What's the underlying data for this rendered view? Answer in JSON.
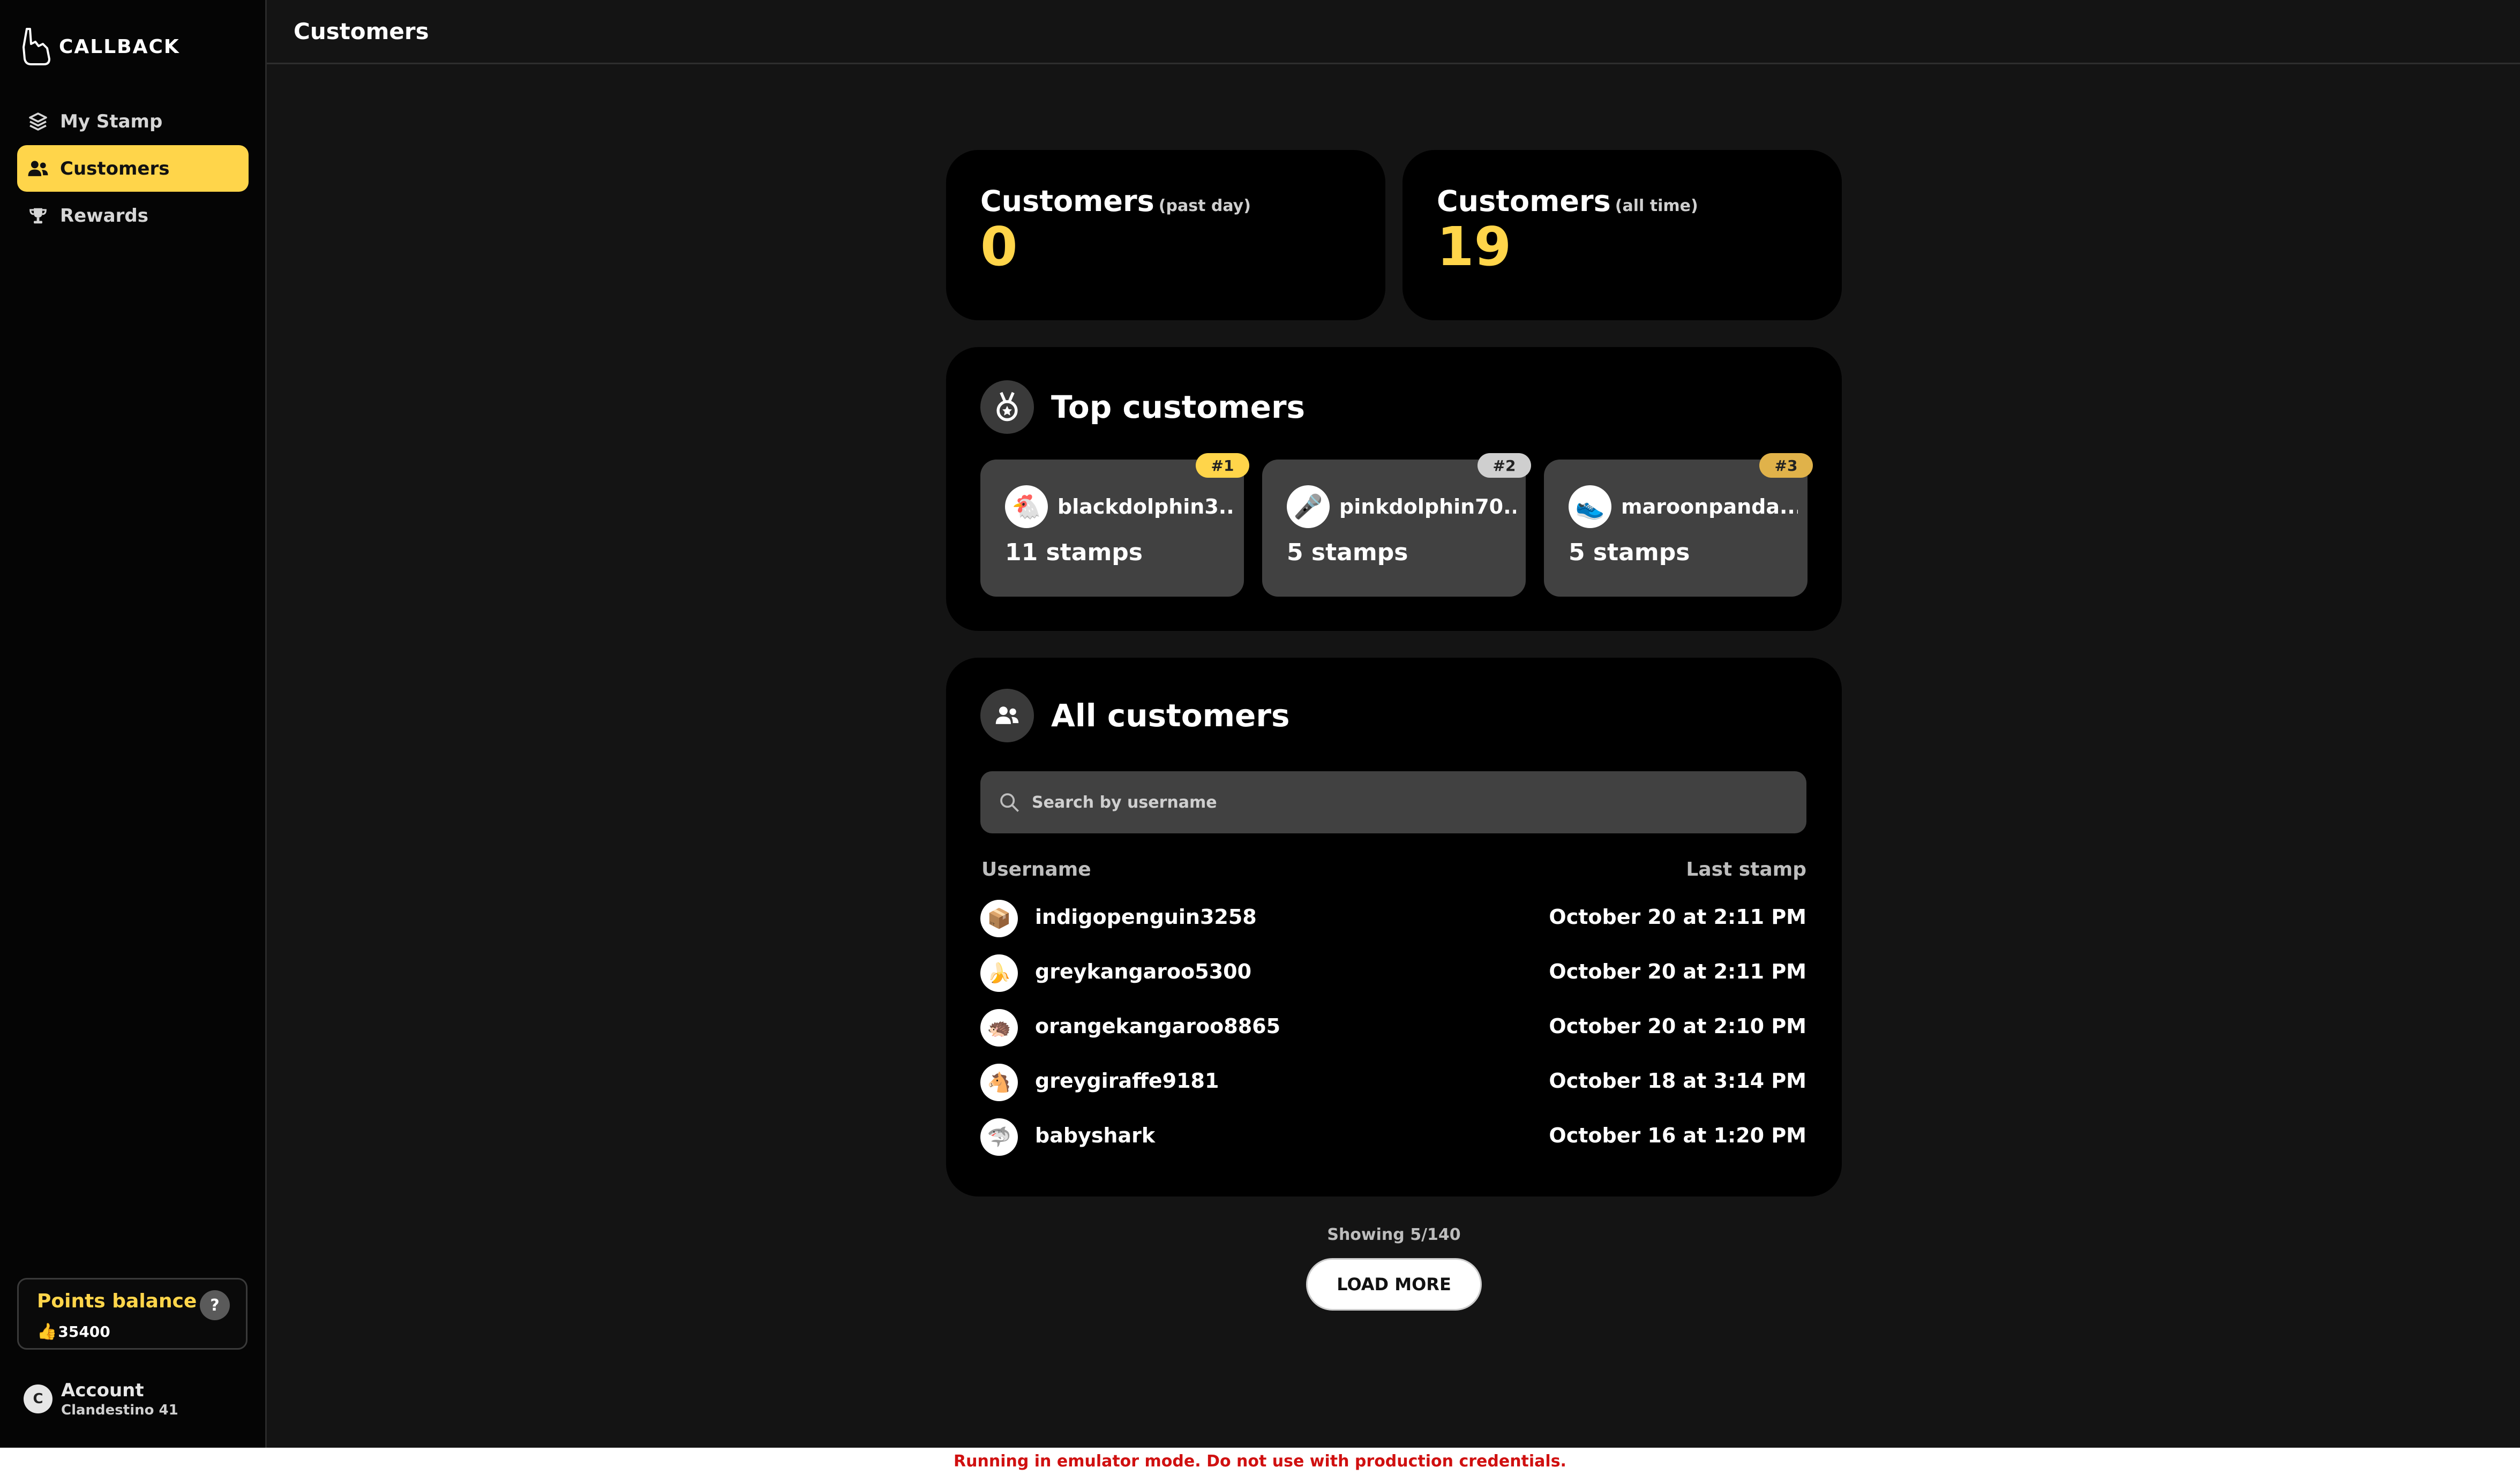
{
  "app": {
    "logo_text": "CALLBACK"
  },
  "sidebar": {
    "items": [
      {
        "label": "My Stamp",
        "icon": "layers-icon",
        "active": false
      },
      {
        "label": "Customers",
        "icon": "users-icon",
        "active": true
      },
      {
        "label": "Rewards",
        "icon": "trophy-icon",
        "active": false
      }
    ],
    "points": {
      "title": "Points balance",
      "help": "?",
      "value": "35400",
      "icon": "hand-icon"
    },
    "account": {
      "title": "Account",
      "subtitle": "Clandestino 41"
    }
  },
  "header": {
    "title": "Customers"
  },
  "stats": {
    "past_day": {
      "title": "Customers",
      "qualifier": "(past day)",
      "value": "0"
    },
    "all_time": {
      "title": "Customers",
      "qualifier": "(all time)",
      "value": "19"
    }
  },
  "top_customers": {
    "title": "Top customers",
    "icon": "medal-icon",
    "items": [
      {
        "rank": "#1",
        "rank_color": "#ffd54a",
        "name": "blackdolphin3...",
        "stamps": "11 stamps",
        "avatar": "🐔"
      },
      {
        "rank": "#2",
        "rank_color": "#cfcfcf",
        "name": "pinkdolphin70...",
        "stamps": "5 stamps",
        "avatar": "🎤"
      },
      {
        "rank": "#3",
        "rank_color": "#e0b24a",
        "name": "maroonpanda...",
        "stamps": "5 stamps",
        "avatar": "👟"
      }
    ]
  },
  "all_customers": {
    "title": "All customers",
    "icon": "users-icon",
    "search_placeholder": "Search by username",
    "columns": {
      "username": "Username",
      "last_stamp": "Last stamp"
    },
    "rows": [
      {
        "avatar": "📦",
        "username": "indigopenguin3258",
        "last_stamp": "October 20 at 2:11 PM"
      },
      {
        "avatar": "🍌",
        "username": "greykangaroo5300",
        "last_stamp": "October 20 at 2:11 PM"
      },
      {
        "avatar": "🦔",
        "username": "orangekangaroo8865",
        "last_stamp": "October 20 at 2:10 PM"
      },
      {
        "avatar": "🐴",
        "username": "greygiraffe9181",
        "last_stamp": "October 18 at 3:14 PM"
      },
      {
        "avatar": "🦈",
        "username": "babyshark",
        "last_stamp": "October 16 at 1:20 PM"
      }
    ],
    "showing": "Showing 5/140",
    "load_more": "LOAD MORE"
  },
  "banner": {
    "text": "Running in emulator mode. Do not use with production credentials."
  },
  "colors": {
    "accent": "#ffd54a",
    "warning": "#d01010"
  }
}
